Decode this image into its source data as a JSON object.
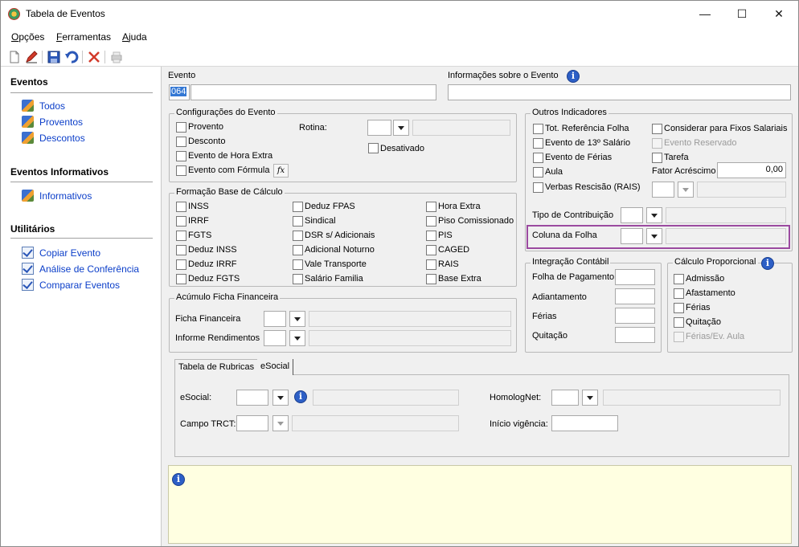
{
  "window": {
    "title": "Tabela de Eventos",
    "minimize": "—",
    "maximize": "☐",
    "close": "✕"
  },
  "menu": [
    {
      "first": "O",
      "rest": "pções"
    },
    {
      "first": "F",
      "rest": "erramentas"
    },
    {
      "first": "A",
      "rest": "juda"
    }
  ],
  "toolbar": {
    "icons": [
      "new-document-icon",
      "edit-pencil-icon",
      "save-icon",
      "undo-icon",
      "delete-icon",
      "print-icon"
    ]
  },
  "sidebar": {
    "eventos": {
      "title": "Eventos",
      "items": [
        "Todos",
        "Proventos",
        "Descontos"
      ]
    },
    "informativos": {
      "title": "Eventos Informativos",
      "items": [
        "Informativos"
      ]
    },
    "utilitarios": {
      "title": "Utilitários",
      "items": [
        "Copiar Evento",
        "Análise de Conferência",
        "Comparar Eventos"
      ]
    }
  },
  "evento": {
    "label": "Evento",
    "code": "064",
    "description": ""
  },
  "informacoes": {
    "label": "Informações sobre o Evento",
    "value": ""
  },
  "config": {
    "title": "Configurações do Evento",
    "options": [
      "Provento",
      "Desconto",
      "Evento de Hora Extra",
      "Evento com Fórmula"
    ],
    "fx": "fx",
    "rotina_label": "Rotina:",
    "rotina_value": "",
    "desativado": "Desativado"
  },
  "formacao": {
    "title": "Formação Base de Cálculo",
    "col1": [
      "INSS",
      "IRRF",
      "FGTS",
      "Deduz INSS",
      "Deduz IRRF",
      "Deduz FGTS"
    ],
    "col2": [
      "Deduz FPAS",
      "Sindical",
      "DSR s/ Adicionais",
      "Adicional Noturno",
      "Vale Transporte",
      "Salário Familia"
    ],
    "col3": [
      "Hora Extra",
      "Piso Comissionado",
      "PIS",
      "CAGED",
      "RAIS",
      "Base Extra"
    ]
  },
  "acumulo": {
    "title": "Acúmulo Ficha Financeira",
    "ficha": "Ficha Financeira",
    "informe": "Informe Rendimentos"
  },
  "outros": {
    "title": "Outros Indicadores",
    "left": [
      "Tot. Referência Folha",
      "Evento de 13º Salário",
      "Evento de Férias",
      "Aula",
      "Verbas Rescisão (RAIS)"
    ],
    "right": [
      "Considerar para Fixos Salariais",
      "Evento Reservado",
      "Tarefa"
    ],
    "fator_label": "Fator Acréscimo",
    "fator_value": "0,00",
    "tipo_label": "Tipo de Contribuição",
    "coluna_label": "Coluna da Folha",
    "highlight_color": "#9b4aa0"
  },
  "integracao": {
    "title": "Integração Contábil",
    "fields": [
      "Folha de Pagamento",
      "Adiantamento",
      "Férias",
      "Quitação"
    ]
  },
  "proporcional": {
    "title": "Cálculo Proporcional",
    "options": [
      "Admissão",
      "Afastamento",
      "Férias",
      "Quitação",
      "Férias/Ev. Aula"
    ]
  },
  "tabs": {
    "items": [
      "Tabela de Rubricas",
      "eSocial"
    ],
    "esocial_label": "eSocial:",
    "homolognet_label": "HomologNet:",
    "campo_trct_label": "Campo TRCT:",
    "inicio_vigencia_label": "Início vigência:"
  },
  "notes": {
    "text": ""
  }
}
